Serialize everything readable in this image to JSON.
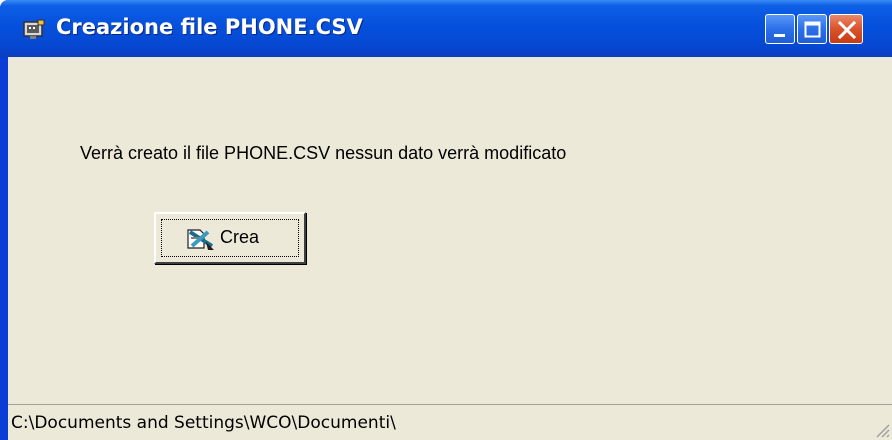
{
  "window": {
    "title": "Creazione file PHONE.CSV",
    "icons": {
      "app": "application-icon",
      "minimize": "minimize-icon",
      "maximize": "maximize-icon",
      "close": "close-icon"
    }
  },
  "main": {
    "message": "Verrà creato il file PHONE.CSV  nessun dato verrà modificato",
    "crea_button": {
      "label": "Crea",
      "icon": "create-file-icon"
    }
  },
  "statusbar": {
    "path": "C:\\Documents and Settings\\WCO\\Documenti\\"
  },
  "colors": {
    "titlebar": "#0550dc",
    "client": "#ece9d8",
    "close": "#d9532b"
  }
}
